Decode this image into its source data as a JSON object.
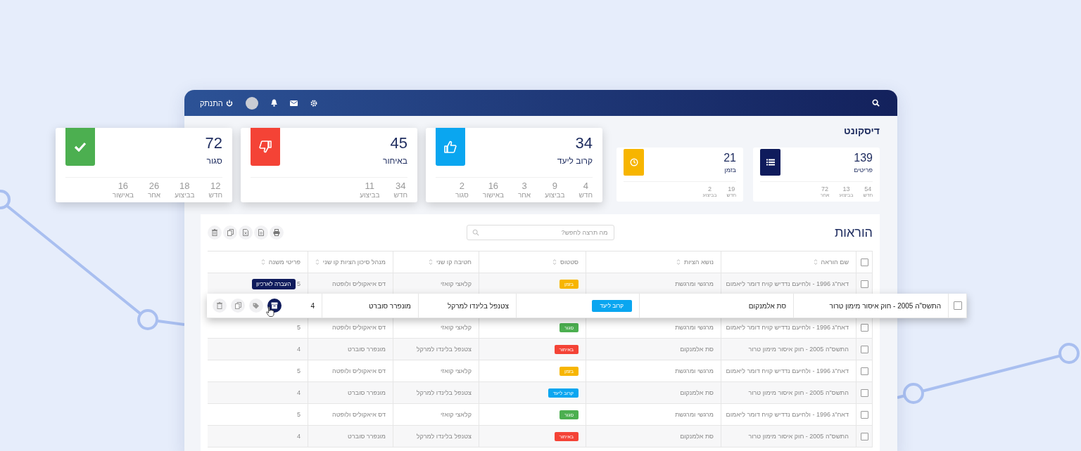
{
  "topbar": {
    "logout": "התנתק"
  },
  "page_title": "דיסקונט",
  "cards": [
    {
      "kind": "total",
      "value": "139",
      "label": "פריטים",
      "color": "#0f1b5c",
      "raised": false,
      "stats": [
        {
          "value": "54",
          "label": "חדש"
        },
        {
          "value": "13",
          "label": "בביצוע"
        },
        {
          "value": "72",
          "label": "אחר"
        }
      ]
    },
    {
      "kind": "ontime",
      "value": "21",
      "label": "בזמן",
      "color": "#f7b500",
      "raised": false,
      "stats": [
        {
          "value": "19",
          "label": "חדש"
        },
        {
          "value": "2",
          "label": "בביצוע"
        }
      ]
    },
    {
      "kind": "near",
      "value": "34",
      "label": "קרוב ליעד",
      "color": "#0aa6f0",
      "raised": true,
      "stats": [
        {
          "value": "4",
          "label": "חדש"
        },
        {
          "value": "9",
          "label": "בביצוע"
        },
        {
          "value": "3",
          "label": "אחר"
        },
        {
          "value": "16",
          "label": "באישור"
        },
        {
          "value": "2",
          "label": "סגור"
        }
      ]
    },
    {
      "kind": "late",
      "value": "45",
      "label": "באיחור",
      "color": "#f44336",
      "raised": true,
      "stats": [
        {
          "value": "34",
          "label": "חדש"
        },
        {
          "value": "11",
          "label": "בביצוע"
        }
      ]
    },
    {
      "kind": "closed",
      "value": "72",
      "label": "סגור",
      "color": "#4caf50",
      "raised": true,
      "stats": [
        {
          "value": "12",
          "label": "חדש"
        },
        {
          "value": "18",
          "label": "בביצוע"
        },
        {
          "value": "26",
          "label": "אחר"
        },
        {
          "value": "16",
          "label": "באישור"
        }
      ]
    }
  ],
  "panel": {
    "title": "הוראות",
    "search": {
      "placeholder": "מה תרצה לחפש?"
    }
  },
  "table": {
    "all_checked": false,
    "columns": [
      "שם הוראה",
      "נושא הציות",
      "סטטוס",
      "חטיבה קו שני",
      "מנהל סיכון הציות קו שני",
      "פריטי משנה"
    ],
    "rows": [
      {
        "checked": false,
        "name": "דאח\"ג 1996 - ולחיעם נדדיש קויח דומר ליאמום",
        "subject": "מרגשי ומרגשת",
        "status": {
          "text": "בזמן",
          "color": "#f7b500"
        },
        "division": "קלאצי קואזי",
        "manager": "דס איאקוליס ולופטה",
        "sub_items": "5"
      },
      {
        "checked": false,
        "name": "דאח\"ג 1996 - ולחיעם נדדיש קויח דומר ליאמום",
        "subject": "מרגשי ומרגשת",
        "status": {
          "text": "סגור",
          "color": "#4caf50"
        },
        "division": "קלאצי קואזי",
        "manager": "דס איאקוליס ולופטה",
        "sub_items": "5"
      },
      {
        "checked": false,
        "name": "התשס\"ה 2005 - חוק איסור מימון טרור",
        "subject": "סת אלמנקום",
        "status": {
          "text": "באיחור",
          "color": "#f44336"
        },
        "division": "צטנפל בלינדו למרקל",
        "manager": "מונפרר סוברט",
        "sub_items": "4"
      },
      {
        "checked": false,
        "name": "דאח\"ג 1996 - ולחיעם נדדיש קויח דומר ליאמום",
        "subject": "מרגשי ומרגשת",
        "status": {
          "text": "בזמן",
          "color": "#f7b500"
        },
        "division": "קלאצי קואזי",
        "manager": "דס איאקוליס ולופטה",
        "sub_items": "5"
      },
      {
        "checked": false,
        "name": "התשס\"ה 2005 - חוק איסור מימון טרור",
        "subject": "סת אלמנקום",
        "status": {
          "text": "קרוב ליעד",
          "color": "#0aa6f0"
        },
        "division": "צטנפל בלינדו למרקל",
        "manager": "מונפרר סוברט",
        "sub_items": "4"
      },
      {
        "checked": false,
        "name": "דאח\"ג 1996 - ולחיעם נדדיש קויח דומר ליאמום",
        "subject": "מרגשי ומרגשת",
        "status": {
          "text": "סגור",
          "color": "#4caf50"
        },
        "division": "קלאצי קואזי",
        "manager": "דס איאקוליס ולופטה",
        "sub_items": "5"
      },
      {
        "checked": false,
        "name": "התשס\"ה 2005 - חוק איסור מימון טרור",
        "subject": "סת אלמנקום",
        "status": {
          "text": "באיחור",
          "color": "#f44336"
        },
        "division": "צטנפל בלינדו למרקל",
        "manager": "מונפרר סוברט",
        "sub_items": "4"
      }
    ],
    "hovered_row": {
      "checked": false,
      "tooltip": "העברה לארכיון",
      "name": "התשס\"ה 2005 - חוק איסור מימון טרור",
      "subject": "סת אלמנקום",
      "status": {
        "text": "קרוב ליעד",
        "color": "#0aa6f0"
      },
      "division": "צטנפל בלינדו למרקל",
      "manager": "מונפרר סוברט",
      "sub_items": "4"
    }
  }
}
